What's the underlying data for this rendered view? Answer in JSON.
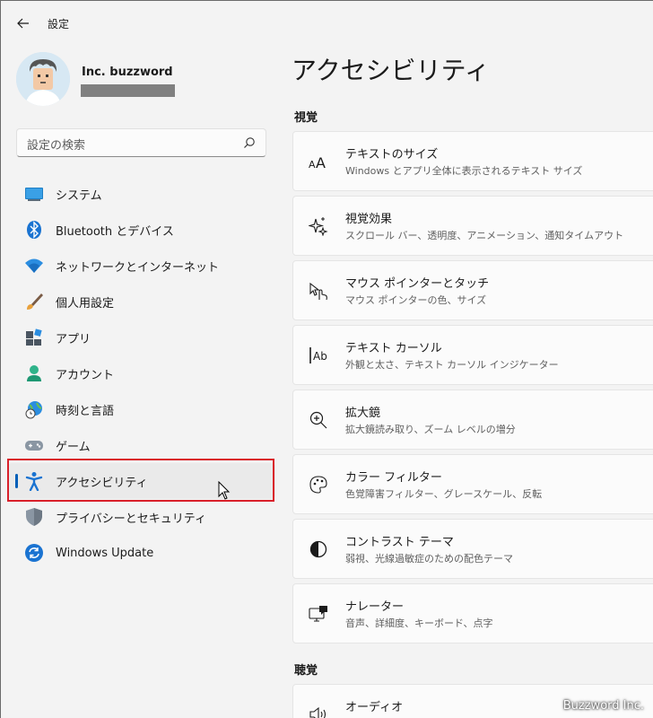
{
  "window": {
    "title": "設定"
  },
  "profile": {
    "name": "Inc. buzzword"
  },
  "search": {
    "placeholder": "設定の検索"
  },
  "nav": {
    "items": [
      {
        "label": "システム",
        "icon": "monitor-icon"
      },
      {
        "label": "Bluetooth とデバイス",
        "icon": "bluetooth-icon"
      },
      {
        "label": "ネットワークとインターネット",
        "icon": "wifi-icon"
      },
      {
        "label": "個人用設定",
        "icon": "brush-icon"
      },
      {
        "label": "アプリ",
        "icon": "apps-icon"
      },
      {
        "label": "アカウント",
        "icon": "person-icon"
      },
      {
        "label": "時刻と言語",
        "icon": "globe-clock-icon"
      },
      {
        "label": "ゲーム",
        "icon": "gamepad-icon"
      },
      {
        "label": "アクセシビリティ",
        "icon": "accessibility-icon",
        "selected": true
      },
      {
        "label": "プライバシーとセキュリティ",
        "icon": "shield-icon"
      },
      {
        "label": "Windows Update",
        "icon": "update-icon"
      }
    ]
  },
  "main": {
    "title": "アクセシビリティ",
    "sections": [
      {
        "label": "視覚",
        "cards": [
          {
            "title": "テキストのサイズ",
            "subtitle": "Windows とアプリ全体に表示されるテキスト サイズ",
            "icon": "text-size-icon"
          },
          {
            "title": "視覚効果",
            "subtitle": "スクロール バー、透明度、アニメーション、通知タイムアウト",
            "icon": "sparkle-icon"
          },
          {
            "title": "マウス ポインターとタッチ",
            "subtitle": "マウス ポインターの色、サイズ",
            "icon": "pointer-touch-icon"
          },
          {
            "title": "テキスト カーソル",
            "subtitle": "外観と太さ、テキスト カーソル インジケーター",
            "icon": "text-cursor-icon"
          },
          {
            "title": "拡大鏡",
            "subtitle": "拡大鏡読み取り、ズーム レベルの増分",
            "icon": "magnifier-icon"
          },
          {
            "title": "カラー フィルター",
            "subtitle": "色覚障害フィルター、グレースケール、反転",
            "icon": "palette-icon"
          },
          {
            "title": "コントラスト テーマ",
            "subtitle": "弱視、光線過敏症のための配色テーマ",
            "icon": "contrast-icon"
          },
          {
            "title": "ナレーター",
            "subtitle": "音声、詳細度、キーボード、点字",
            "icon": "narrator-icon"
          }
        ]
      },
      {
        "label": "聴覚",
        "cards": [
          {
            "title": "オーディオ",
            "subtitle": "",
            "icon": "speaker-icon"
          }
        ]
      }
    ]
  },
  "watermark": "Buzzword Inc.",
  "colors": {
    "accent": "#005fb8",
    "highlight": "#d9202a",
    "background": "#f3f3f3",
    "card": "#fbfbfb"
  }
}
